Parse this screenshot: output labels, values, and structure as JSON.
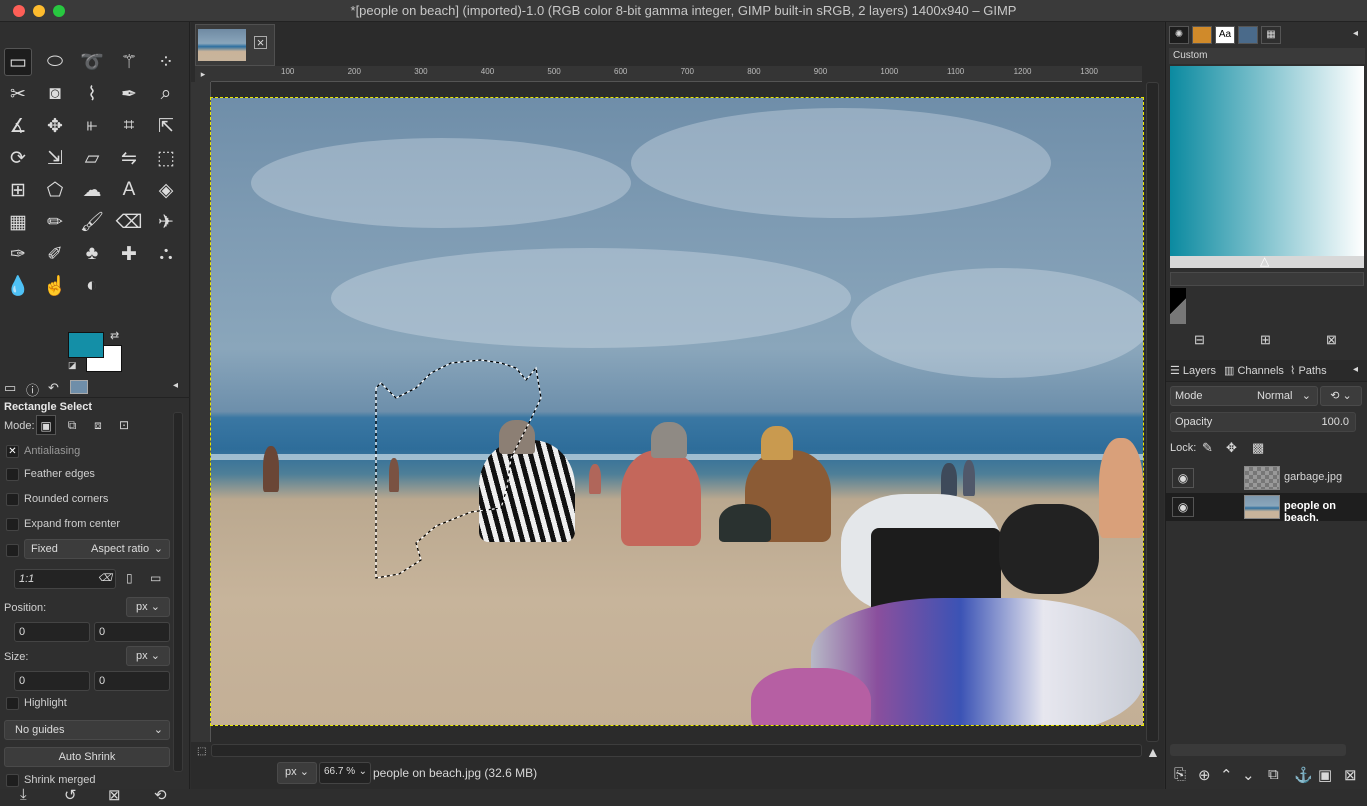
{
  "window": {
    "title": "*[people on beach] (imported)-1.0 (RGB color 8-bit gamma integer, GIMP built-in sRGB, 2 layers) 1400x940 – GIMP"
  },
  "colors": {
    "foreground": "#148fa7",
    "background": "#ffffff",
    "gradient_start": "#0b8aa0",
    "gradient_end": "#ffffff"
  },
  "toolbox": {
    "tools": [
      "rectangle-select-icon",
      "ellipse-select-icon",
      "free-select-icon",
      "fuzzy-select-icon",
      "select-by-color-icon",
      "scissors-select-icon",
      "foreground-select-icon",
      "paths-icon",
      "color-picker-icon",
      "zoom-icon",
      "measure-icon",
      "move-icon",
      "align-icon",
      "crop-icon",
      "unified-transform-icon",
      "rotate-icon",
      "scale-icon",
      "shear-icon",
      "flip-icon",
      "perspective-icon",
      "warp-transform-icon",
      "cage-transform-icon",
      "smudge-warp-icon",
      "text-icon",
      "bucket-fill-icon",
      "gradient-icon",
      "pencil-icon",
      "paintbrush-icon",
      "eraser-icon",
      "airbrush-icon",
      "ink-icon",
      "mypaint-brush-icon",
      "clone-icon",
      "heal-icon",
      "perspective-clone-icon",
      "blur-icon",
      "smudge-icon",
      "dodge-burn-icon"
    ]
  },
  "tool_options": {
    "title": "Rectangle Select",
    "mode_label": "Mode:",
    "antialiasing": "Antialiasing",
    "feather_edges": "Feather edges",
    "rounded_corners": "Rounded corners",
    "expand_from_center": "Expand from center",
    "fixed": "Fixed",
    "fixed_option": "Aspect ratio",
    "ratio": "1:1",
    "position_label": "Position:",
    "position_unit": "px",
    "position_x": "0",
    "position_y": "0",
    "size_label": "Size:",
    "size_unit": "px",
    "size_w": "0",
    "size_h": "0",
    "highlight": "Highlight",
    "guides": "No guides",
    "auto_shrink": "Auto Shrink",
    "shrink_merged": "Shrink merged"
  },
  "canvas": {
    "ruler_labels": [
      "100",
      "200",
      "300",
      "400",
      "500",
      "600",
      "700",
      "800",
      "900",
      "1000",
      "1100",
      "1200",
      "1300"
    ],
    "status_unit": "px",
    "zoom": "66.7 %",
    "status_text": "people on beach.jpg (32.6 MB)"
  },
  "right_panel": {
    "gradient_name": "Custom",
    "tabs": {
      "layers": "Layers",
      "channels": "Channels",
      "paths": "Paths"
    },
    "mode_label": "Mode",
    "mode_value": "Normal",
    "opacity_label": "Opacity",
    "opacity_value": "100.0",
    "lock_label": "Lock:",
    "layers": [
      {
        "name": "garbage.jpg",
        "visible": true,
        "active": false
      },
      {
        "name": "people on beach.",
        "visible": true,
        "active": true
      }
    ]
  }
}
